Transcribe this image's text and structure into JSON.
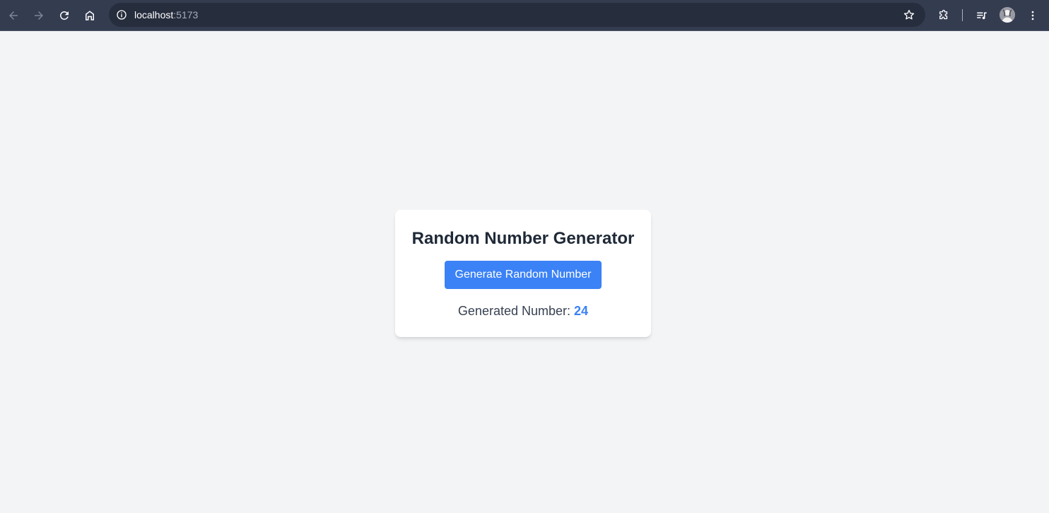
{
  "browser": {
    "url_host": "localhost",
    "url_port": ":5173",
    "icons": [
      "back-icon",
      "forward-icon",
      "reload-icon",
      "home-icon",
      "site-info-icon",
      "bookmark-star-icon",
      "extensions-icon",
      "media-controls-icon",
      "profile-avatar",
      "more-menu-icon"
    ]
  },
  "app": {
    "title": "Random Number Generator",
    "button_label": "Generate Random Number",
    "result_label": "Generated Number:",
    "result_value": "24"
  },
  "colors": {
    "page_background": "#f3f4f6",
    "toolbar": "#343c50",
    "button": "#3b82f6",
    "result_value": "#3b82f6",
    "title_text": "#1f2937"
  }
}
